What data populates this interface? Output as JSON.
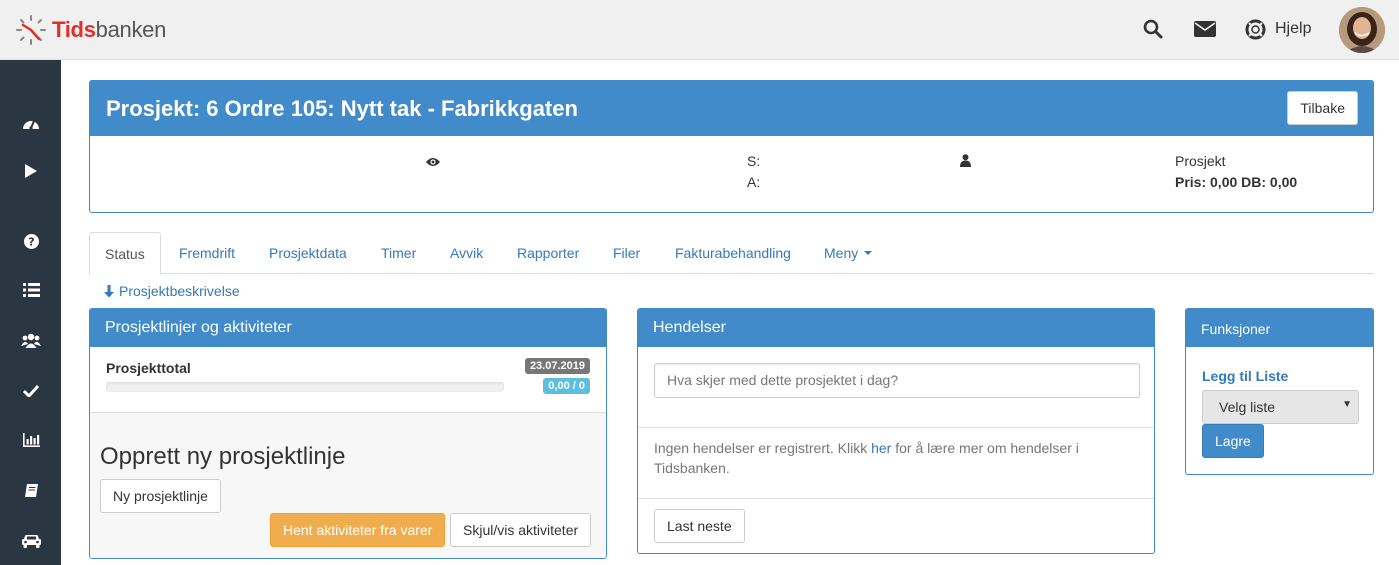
{
  "app": {
    "logo_bold": "Tids",
    "logo_rest": "banken"
  },
  "topbar": {
    "help_label": "Hjelp"
  },
  "project": {
    "title": "Prosjekt: 6 Ordre 105: Nytt tak - Fabrikkgaten",
    "back_label": "Tilbake",
    "s_label": "S:",
    "a_label": "A:",
    "type_label": "Prosjekt",
    "price_label": "Pris: 0,00 DB: 0,00"
  },
  "tabs": [
    {
      "label": "Status"
    },
    {
      "label": "Fremdrift"
    },
    {
      "label": "Prosjektdata"
    },
    {
      "label": "Timer"
    },
    {
      "label": "Avvik"
    },
    {
      "label": "Rapporter"
    },
    {
      "label": "Filer"
    },
    {
      "label": "Fakturabehandling"
    },
    {
      "label": "Meny"
    }
  ],
  "description_link": "Prosjektbeskrivelse",
  "lines_panel": {
    "title": "Prosjektlinjer og aktiviteter",
    "total_label": "Prosjekttotal",
    "date_badge": "23.07.2019",
    "value_badge": "0,00 / 0",
    "progress": 0,
    "create_heading": "Opprett ny prosjektlinje",
    "new_line_button": "Ny prosjektlinje",
    "fetch_button": "Hent aktiviteter fra varer",
    "toggle_button": "Skjul/vis aktiviteter"
  },
  "events_panel": {
    "title": "Hendelser",
    "placeholder": "Hva skjer med dette prosjektet i dag?",
    "info_before": "Ingen hendelser er registrert. Klikk ",
    "info_link": "her",
    "info_after": " for å lære mer om hendelser i Tidsbanken.",
    "load_next_button": "Last neste"
  },
  "functions_panel": {
    "title": "Funksjoner",
    "add_to_list_label": "Legg til Liste",
    "select_value": "Velg liste",
    "save_button": "Lagre"
  },
  "colors": {
    "primary": "#428bca",
    "sidebar": "#2b3643",
    "warning": "#f0ad4e",
    "badge_gray": "#777777",
    "badge_info": "#5bc0de",
    "logo_red": "#e0302b"
  }
}
